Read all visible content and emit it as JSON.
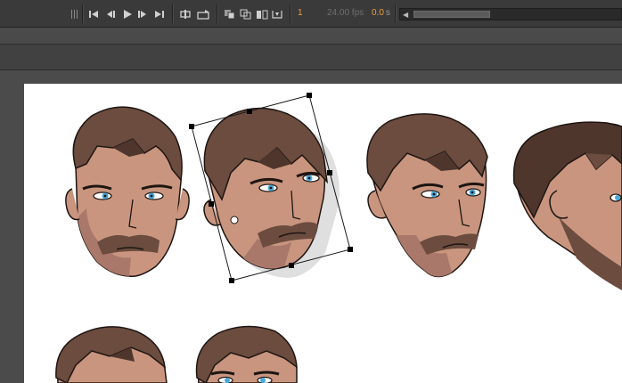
{
  "timeline": {
    "current_frame": "1",
    "fps": "24.00 fps",
    "elapsed_value": "0.0",
    "elapsed_unit": "s"
  },
  "colors": {
    "hair": "#6b4c3e",
    "hair_dark": "#4e362c",
    "skin": "#c9957f",
    "skin_shadow": "#a9786a",
    "outline": "#1e1512",
    "eye_iris": "#4aa8d8",
    "accent_orange": "#e7a23b"
  },
  "icons": [
    "grip-handle-icon",
    "first-frame-icon",
    "step-back-icon",
    "play-icon",
    "step-forward-icon",
    "last-frame-icon",
    "loop-icon",
    "center-frame-icon",
    "onion-skin-icon",
    "onion-skin-outline-icon",
    "edit-multiple-frames-icon",
    "modify-markers-icon",
    "scroll-left-arrow-icon"
  ]
}
